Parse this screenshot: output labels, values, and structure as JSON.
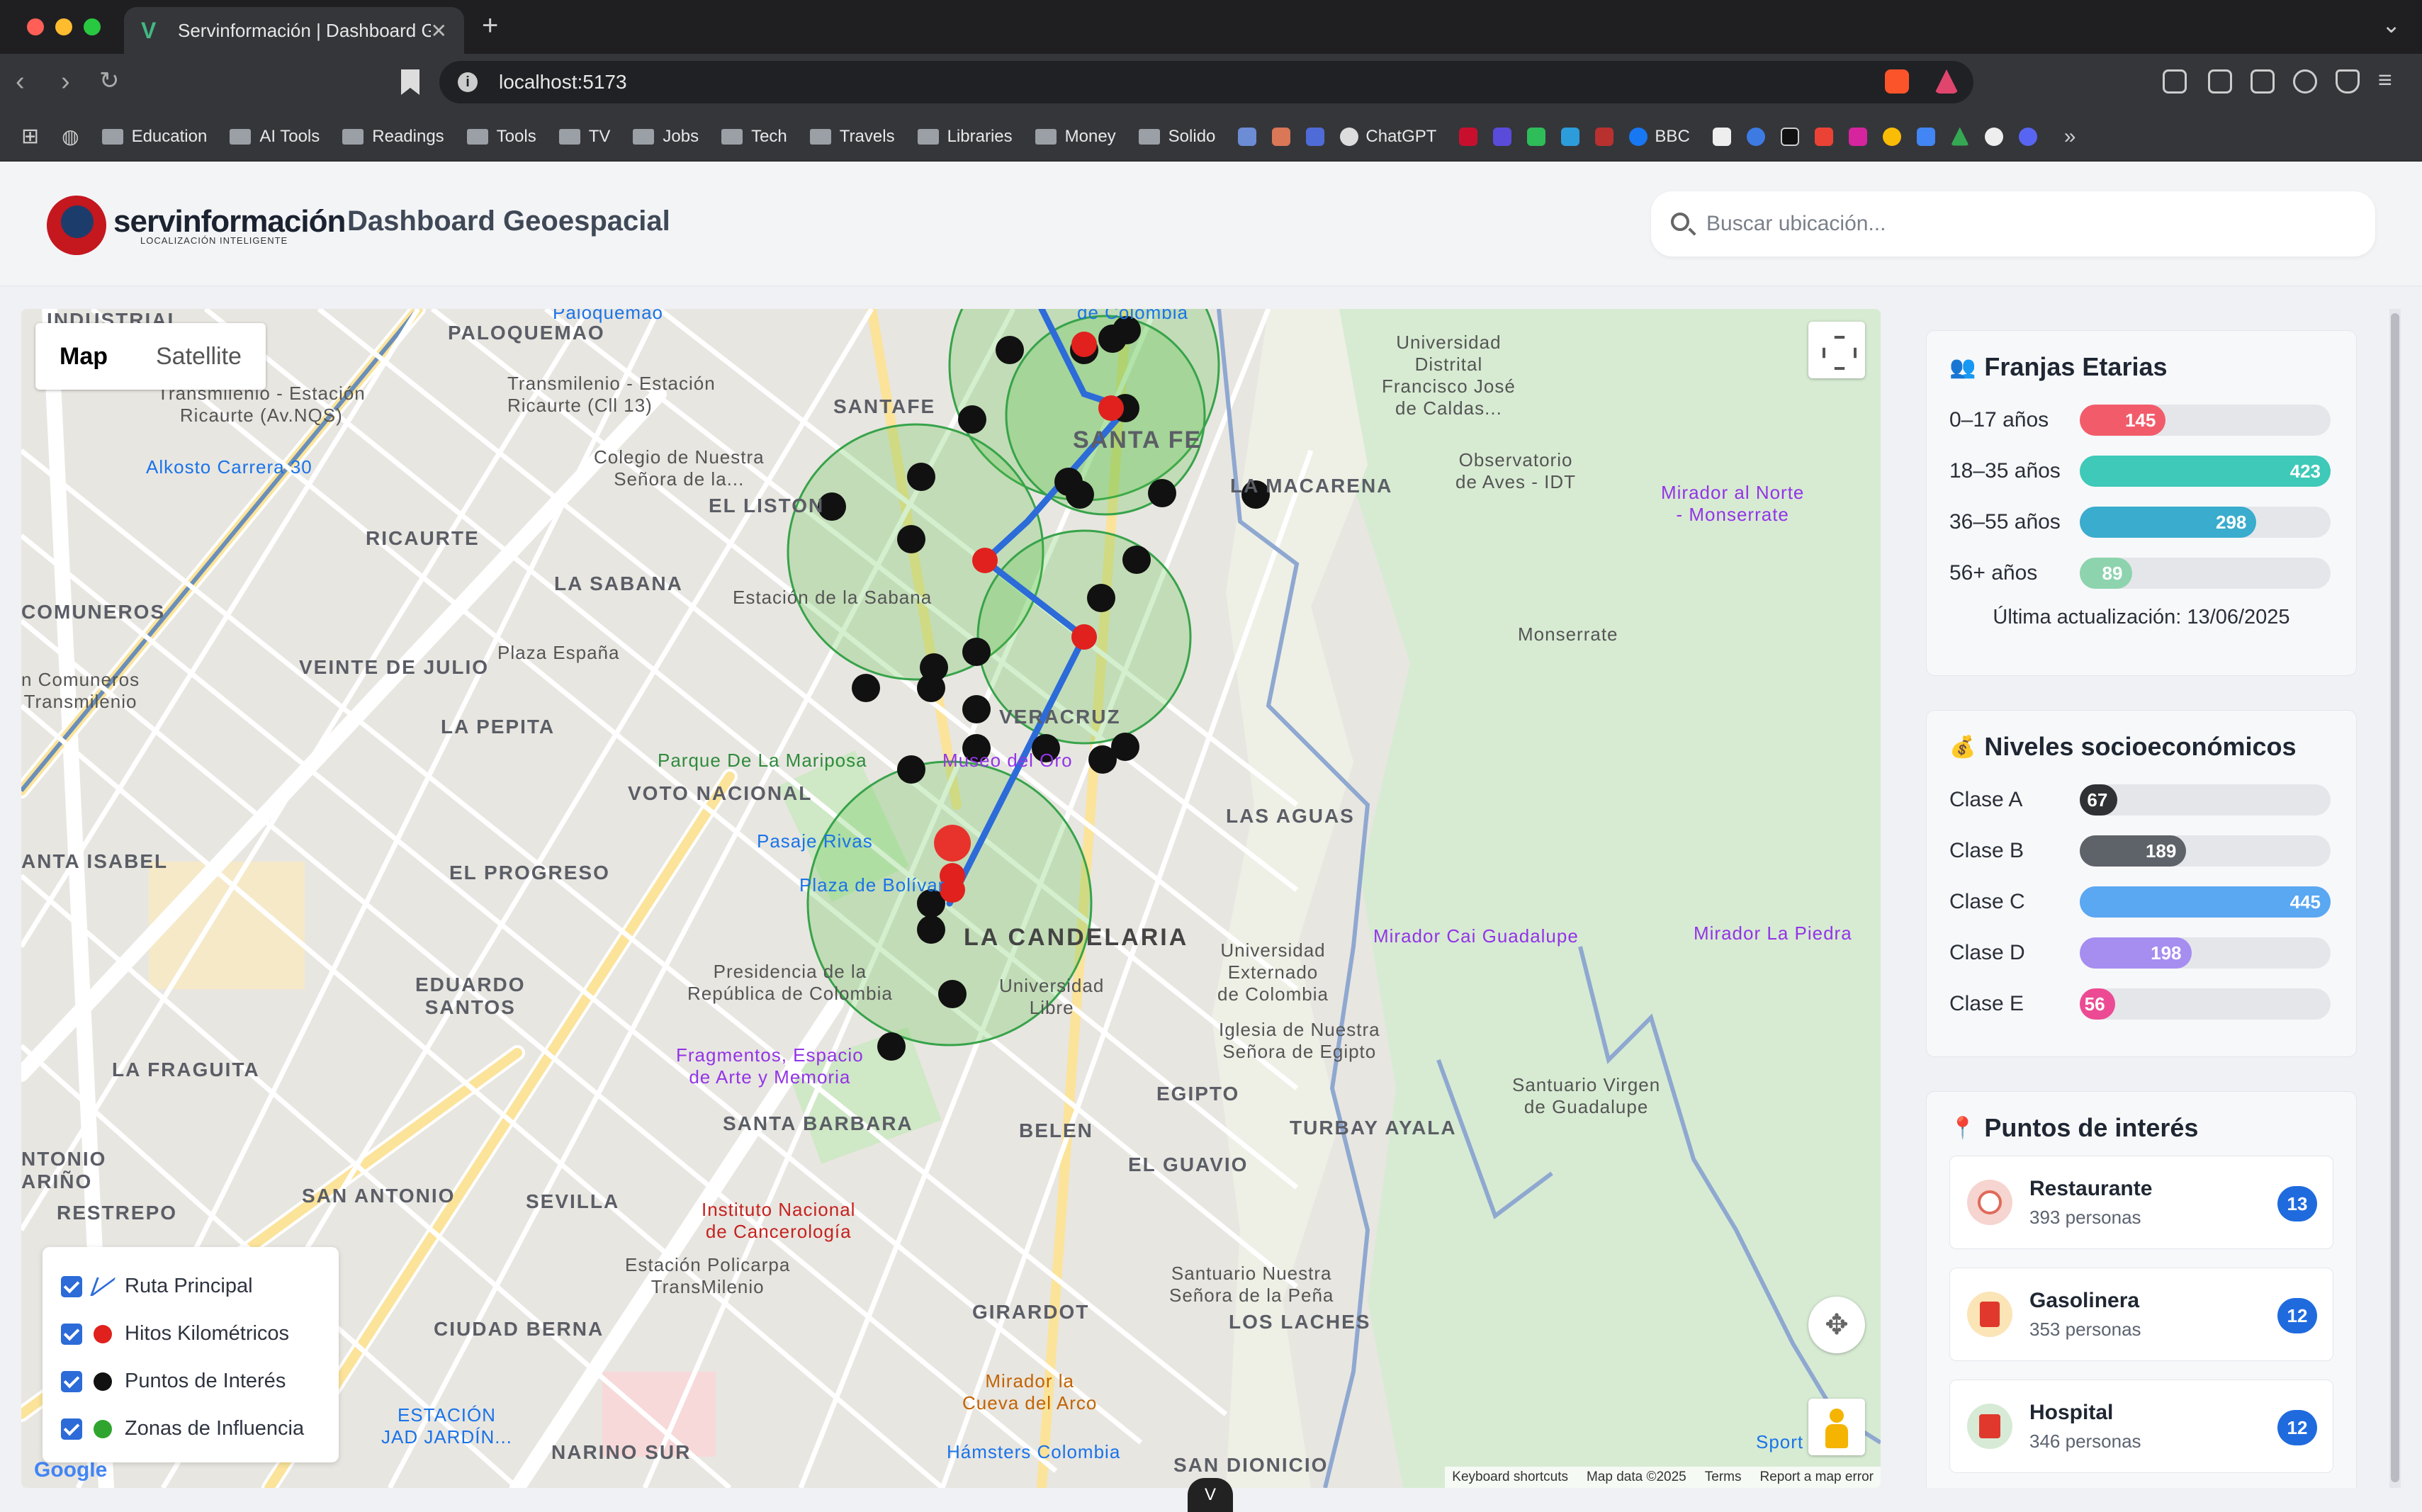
{
  "browser": {
    "tab_title": "Servinformación | Dashboard G",
    "url": "localhost:5173",
    "bookmarks": [
      "Education",
      "AI Tools",
      "Readings",
      "Tools",
      "TV",
      "Jobs",
      "Tech",
      "Travels",
      "Libraries",
      "Money",
      "Solido"
    ],
    "bookmark_sites": [
      "ChatGPT",
      "BBC"
    ]
  },
  "header": {
    "logo_name": "servinformación",
    "logo_tagline": "LOCALIZACIÓN INTELIGENTE",
    "title": "Dashboard Geoespacial",
    "search_placeholder": "Buscar ubicación..."
  },
  "map": {
    "type_map": "Map",
    "type_satellite": "Satellite",
    "attribution": [
      "Keyboard shortcuts",
      "Map data ©2025",
      "Terms",
      "Report a map error"
    ],
    "google": "Google",
    "labels": {
      "industrial": "INDUSTRIAL",
      "paloquemao": "PALOQUEMAO",
      "paloquemao_top": "Paloquemao",
      "santafe": "SANTAFE",
      "santa_fe": "SANTA FE",
      "la_macarena": "LA MACARENA",
      "el_liston": "EL LISTON",
      "ricaurte": "RICAURTE",
      "la_sabana": "LA SABANA",
      "comuneros": "COMUNEROS",
      "veinte_julio": "VEINTE DE JULIO",
      "la_pepita": "LA PEPITA",
      "voto_nacional": "VOTO NACIONAL",
      "veracruz": "VERACRUZ",
      "las_aguas": "LAS AGUAS",
      "santa_isabel": "ANTA ISABEL",
      "el_progreso": "EL PROGRESO",
      "la_candelaria": "LA CANDELARIA",
      "eduardo_santos": "EDUARDO\nSANTOS",
      "la_fraguita": "LA FRAGUITA",
      "santa_barbara": "SANTA BARBARA",
      "belen": "BELEN",
      "egipto": "EGIPTO",
      "turbay_ayala": "TURBAY AYALA",
      "el_guavio": "EL GUAVIO",
      "san_antonio": "SAN ANTONIO",
      "sevilla": "SEVILLA",
      "restrepo": "RESTREPO",
      "antonio_narino": "NTONIO\nARIÑO",
      "ciudad_berna": "CIUDAD BERNA",
      "girardot": "GIRARDOT",
      "los_laches": "LOS LACHES",
      "narino_sur": "NARINO SUR",
      "san_dionicio": "SAN DIONICIO",
      "transmilenio_ricaurte_nqs": "Transmilenio - Estación\nRicaurte (Av.NQS)",
      "transmilenio_ricaurte_13": "Transmilenio - Estación\nRicaurte (Cll 13)",
      "alkosto": "Alkosto Carrera 30",
      "colegio": "Colegio de Nuestra\nSeñora de la...",
      "estacion_sabana": "Estación de la Sabana",
      "plaza_espana": "Plaza España",
      "comuneros_tm": "n Comuneros\nTransmilenio",
      "parque_mariposa": "Parque De La Mariposa",
      "museo_oro": "Museo del Oro",
      "pasaje_rivas": "Pasaje Rivas",
      "plaza_bolivar": "Plaza de Bolívar",
      "presidencia": "Presidencia de la\nRepública de Colombia",
      "u_libre": "Universidad\nLibre",
      "fragmentos": "Fragmentos, Espacio\nde Arte y Memoria",
      "u_externado": "Universidad\nExternado\nde Colombia",
      "iglesia_egipto": "Iglesia de Nuestra\nSeñora de Egipto",
      "u_distrital": "Universidad\nDistrital\nFrancisco José\nde Caldas...",
      "observatorio": "Observatorio\nde Aves - IDT",
      "mirador_norte": "Mirador al Norte\n- Monserrate",
      "monserrate": "Monserrate",
      "mirador_guadalupe": "Mirador Cai Guadalupe",
      "mirador_piedra": "Mirador La Piedra",
      "santuario": "Santuario Virgen\nde Guadalupe",
      "instituto": "Instituto Nacional\nde Cancerología",
      "estacion_policarpa": "Estación Policarpa\nTransMilenio",
      "santuario_pena": "Santuario Nuestra\nSeñora de la Peña",
      "mirador_cueva": "Mirador la\nCueva del Arco",
      "hamsters": "Hámsters Colombia",
      "estacion_jardin": "ESTACIÓN\nJAD JARDÍN...",
      "de_colombia": "de Colombia",
      "sport": "Sport"
    }
  },
  "legend": {
    "items": [
      {
        "label": "Ruta Principal",
        "color": "#2c6bd8"
      },
      {
        "label": "Hitos Kilométricos",
        "color": "#e0211d"
      },
      {
        "label": "Puntos de Interés",
        "color": "#111111"
      },
      {
        "label": "Zonas de Influencia",
        "color": "#2fa52f"
      }
    ]
  },
  "age": {
    "title": "Franjas Etarias",
    "items": [
      {
        "label": "0–17 años",
        "value": 145,
        "max": 423,
        "color": "#f25c6a"
      },
      {
        "label": "18–35 años",
        "value": 423,
        "max": 423,
        "color": "#3ec9b8"
      },
      {
        "label": "36–55 años",
        "value": 298,
        "max": 423,
        "color": "#3aaccd"
      },
      {
        "label": "56+ años",
        "value": 89,
        "max": 423,
        "color": "#8dd3ae"
      }
    ],
    "updated": "Última actualización: 13/06/2025"
  },
  "socio": {
    "title": "Niveles socioeconómicos",
    "items": [
      {
        "label": "Clase A",
        "value": 67,
        "max": 445,
        "color": "#2f3135"
      },
      {
        "label": "Clase B",
        "value": 189,
        "max": 445,
        "color": "#5e6369"
      },
      {
        "label": "Clase C",
        "value": 445,
        "max": 445,
        "color": "#5aa7f2"
      },
      {
        "label": "Clase D",
        "value": 198,
        "max": 445,
        "color": "#a68df0"
      },
      {
        "label": "Clase E",
        "value": 56,
        "max": 445,
        "color": "#ec4b93"
      }
    ]
  },
  "poi": {
    "title": "Puntos de interés",
    "items": [
      {
        "name": "Restaurante",
        "people": "393 personas",
        "count": "13",
        "color": "#f6d4cf"
      },
      {
        "name": "Gasolinera",
        "people": "353 personas",
        "count": "12",
        "color": "#fbe4b6"
      },
      {
        "name": "Hospital",
        "people": "346 personas",
        "count": "12",
        "color": "#d6ead6"
      }
    ]
  }
}
